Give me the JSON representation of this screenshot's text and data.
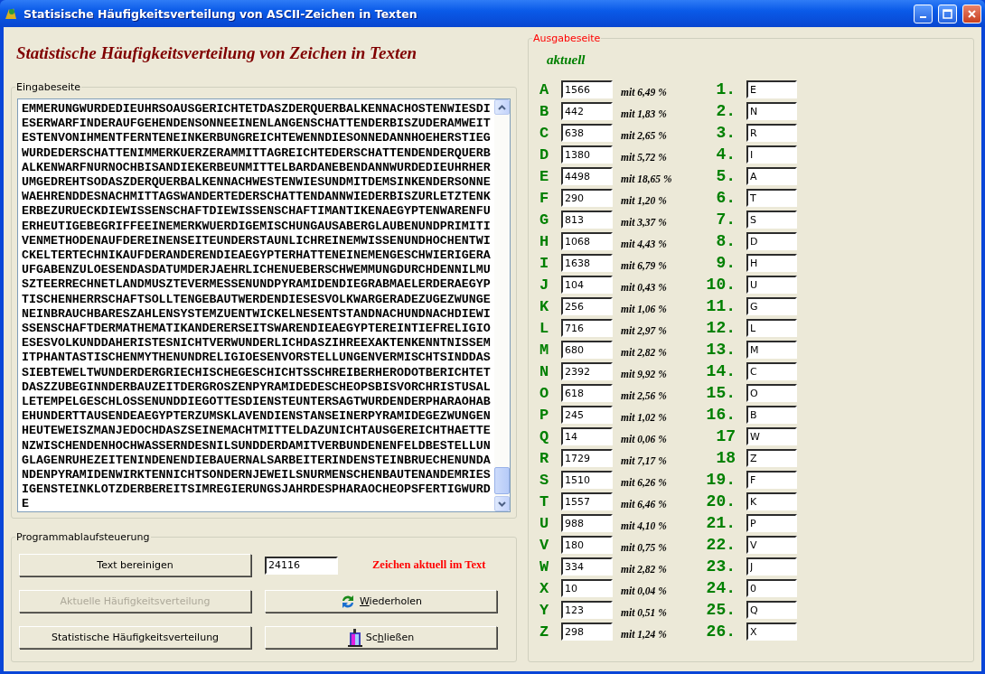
{
  "window": {
    "title": "Statisische Häufigkeitsverteilung von ASCII-Zeichen in Texten"
  },
  "heading": "Statistische Häufigkeitsverteilung von Zeichen in Texten",
  "input_group": {
    "legend": "Eingabeseite",
    "text_lines": [
      "EMMERUNGWURDEDIEUHRSOAUSGERICHTETDASZDERQUERBALKENNACHOSTENWIESDI",
      "ESERWARFINDERAUFGEHENDENSONNEEINENLANGENSCHATTENDERBISZUDERAMWEIT",
      "ESTENVONIHMENTFERNTENEINKERBUNGREICHTEWENNDIESONNEDANNHOEHERSTIEG",
      "WURDEDERSCHATTENIMMERKUERZERAMMITTAGREICHTEDERSCHATTENDENDERQUERB",
      "ALKENWARFNURNOCHBISANDIEKERBEUNMITTELBARDANEBENDANNWURDEDIEUHRHER",
      "UMGEDREHTSODASZDERQUERBALKENNACHWESTENWIESUNDMITDEMSINKENDERSONNE",
      "WAEHRENDDESNACHMITTAGSWANDERTEDERSCHATTENDANNWIEDERBISZURLETZTENK",
      "ERBEZURUECKDIEWISSENSCHAFTDIEWISSENSCHAFTIMANTIKENAEGYPTENWARENFU",
      "ERHEUTIGEBEGRIFFEEINEMERKWUERDIGEMISCHUNGAUSABERGLAUBENUNDPRIMITI",
      "VENMETHODENAUFDEREINENSEITEUNDERSTAUNLICHREINEMWISSENUNDHOCHENTWI",
      "CKELTERTECHNIKAUFDERANDERENDIEAEGYPTERHATTENEINEMENGESCHWIERIGERA",
      "UFGABENZULOESENDASDATUMDERJAEHRLICHENUEBERSCHWEMMUNGDURCHDENNILMU",
      "SZTEERRECHNETLANDMUSZTEVERMESSENUNDPYRAMIDENDIEGRABMAELERDERAEGYP",
      "TISCHENHERRSCHAFTSOLLTENGEBAUTWERDENDIESESVOLKWARGERADEZUGEZWUNGE",
      "NEINBRAUCHBARESZAHLENSYSTEMZUENTWICKELNESENTSTANDNACHUNDNACHDIEWI",
      "SSENSCHAFTDERMATHEMATIKANDERERSEITSWARENDIEAEGYPTEREINTIEFRELIGIO",
      "ESESVOLKUNDDAHERISTESNICHTVERWUNDERLICHDASZIHREEXAKTENKENNTNISSEM",
      "ITPHANTASTISCHENMYTHENUNDRELIGIOESENVORSTELLUNGENVERMISCHTSINDDAS",
      "SIEBTEWELTWUNDERDERGRIECHISCHEGESCHICHTSSCHREIBERHERODOTBERICHTET",
      "DASZZUBEGINNDERBAUZEITDERGROSZENPYRAMIDEDESCHEOPSBISVORCHRISTUSAL",
      "LETEMPELGESCHLOSSENUNDDIEGOTTESDIENSTEUNTERSAGTWURDENDERPHARAOHAB",
      "EHUNDERTTAUSENDEAEGYPTERZUMSKLAVENDIENSTANSEINERPYRAMIDEGEZWUNGEN",
      "HEUTEWEISZMANJEDOCHDASZSEINEMACHTMITTELDAZUNICHTAUSGEREICHTHAETTE",
      "NZWISCHENDENHOCHWASSERNDESNILSUNDDERDAMITVERBUNDENENFELDBESTELLUN",
      "GLAGENRUHEZEITENINDENENDIEBAUERNALSARBEITERINDENSTEINBRUECHENUNDA",
      "NDENPYRAMIDENWIRKTENNICHTSONDERNJEWEILSNURMENSCHENBAUTENANDEMRIES",
      "IGENSTEINKLOTZDERBEREITSIMREGIERUNGSJAHRDESPHARAOCHEOPSFERTIGWURD",
      "E"
    ]
  },
  "control_group": {
    "legend": "Programmablaufsteuerung",
    "counter_value": "24116",
    "counter_label": "Zeichen aktuell im Text",
    "buttons": [
      {
        "kind": "plain",
        "label": "Text bereinigen",
        "disabled": false
      },
      {
        "kind": "plain",
        "label": "Aktuelle Häufigkeitsverteilung",
        "disabled": true
      },
      {
        "kind": "refresh",
        "key": "W",
        "after": "iederholen",
        "disabled": false
      },
      {
        "kind": "plain",
        "label": "Statistische Häufigkeitsverteilung",
        "disabled": false
      },
      {
        "kind": "exit",
        "before": "Sc",
        "key": "h",
        "after": "ließen",
        "disabled": false
      }
    ]
  },
  "output_group": {
    "legend": "Ausgabeseite",
    "subtitle": "aktuell",
    "rows": [
      {
        "letter": "A",
        "count": "1566",
        "percent": "mit 6,49 %",
        "rank": "1.",
        "ranked": "E"
      },
      {
        "letter": "B",
        "count": "442",
        "percent": "mit 1,83 %",
        "rank": "2.",
        "ranked": "N"
      },
      {
        "letter": "C",
        "count": "638",
        "percent": "mit 2,65 %",
        "rank": "3.",
        "ranked": "R"
      },
      {
        "letter": "D",
        "count": "1380",
        "percent": "mit 5,72 %",
        "rank": "4.",
        "ranked": "I"
      },
      {
        "letter": "E",
        "count": "4498",
        "percent": "mit 18,65 %",
        "rank": "5.",
        "ranked": "A"
      },
      {
        "letter": "F",
        "count": "290",
        "percent": "mit 1,20 %",
        "rank": "6.",
        "ranked": "T"
      },
      {
        "letter": "G",
        "count": "813",
        "percent": "mit 3,37 %",
        "rank": "7.",
        "ranked": "S"
      },
      {
        "letter": "H",
        "count": "1068",
        "percent": "mit 4,43 %",
        "rank": "8.",
        "ranked": "D"
      },
      {
        "letter": "I",
        "count": "1638",
        "percent": "mit 6,79 %",
        "rank": "9.",
        "ranked": "H"
      },
      {
        "letter": "J",
        "count": "104",
        "percent": "mit 0,43 %",
        "rank": "10.",
        "ranked": "U"
      },
      {
        "letter": "K",
        "count": "256",
        "percent": "mit 1,06 %",
        "rank": "11.",
        "ranked": "G"
      },
      {
        "letter": "L",
        "count": "716",
        "percent": "mit 2,97 %",
        "rank": "12.",
        "ranked": "L"
      },
      {
        "letter": "M",
        "count": "680",
        "percent": "mit 2,82 %",
        "rank": "13.",
        "ranked": "M"
      },
      {
        "letter": "N",
        "count": "2392",
        "percent": "mit 9,92 %",
        "rank": "14.",
        "ranked": "C"
      },
      {
        "letter": "O",
        "count": "618",
        "percent": "mit 2,56 %",
        "rank": "15.",
        "ranked": "O"
      },
      {
        "letter": "P",
        "count": "245",
        "percent": "mit 1,02 %",
        "rank": "16.",
        "ranked": "B"
      },
      {
        "letter": "Q",
        "count": "14",
        "percent": "mit 0,06 %",
        "rank": "17",
        "ranked": "W"
      },
      {
        "letter": "R",
        "count": "1729",
        "percent": "mit 7,17 %",
        "rank": "18",
        "ranked": "Z"
      },
      {
        "letter": "S",
        "count": "1510",
        "percent": "mit 6,26 %",
        "rank": "19.",
        "ranked": "F"
      },
      {
        "letter": "T",
        "count": "1557",
        "percent": "mit 6,46 %",
        "rank": "20.",
        "ranked": "K"
      },
      {
        "letter": "U",
        "count": "988",
        "percent": "mit 4,10 %",
        "rank": "21.",
        "ranked": "P"
      },
      {
        "letter": "V",
        "count": "180",
        "percent": "mit 0,75 %",
        "rank": "22.",
        "ranked": "V"
      },
      {
        "letter": "W",
        "count": "334",
        "percent": "mit 2,82 %",
        "rank": "23.",
        "ranked": "J"
      },
      {
        "letter": "X",
        "count": "10",
        "percent": "mit 0,04 %",
        "rank": "24.",
        "ranked": "0"
      },
      {
        "letter": "Y",
        "count": "123",
        "percent": "mit 0,51 %",
        "rank": "25.",
        "ranked": "Q"
      },
      {
        "letter": "Z",
        "count": "298",
        "percent": "mit 1,24 %",
        "rank": "26.",
        "ranked": "X"
      }
    ]
  }
}
